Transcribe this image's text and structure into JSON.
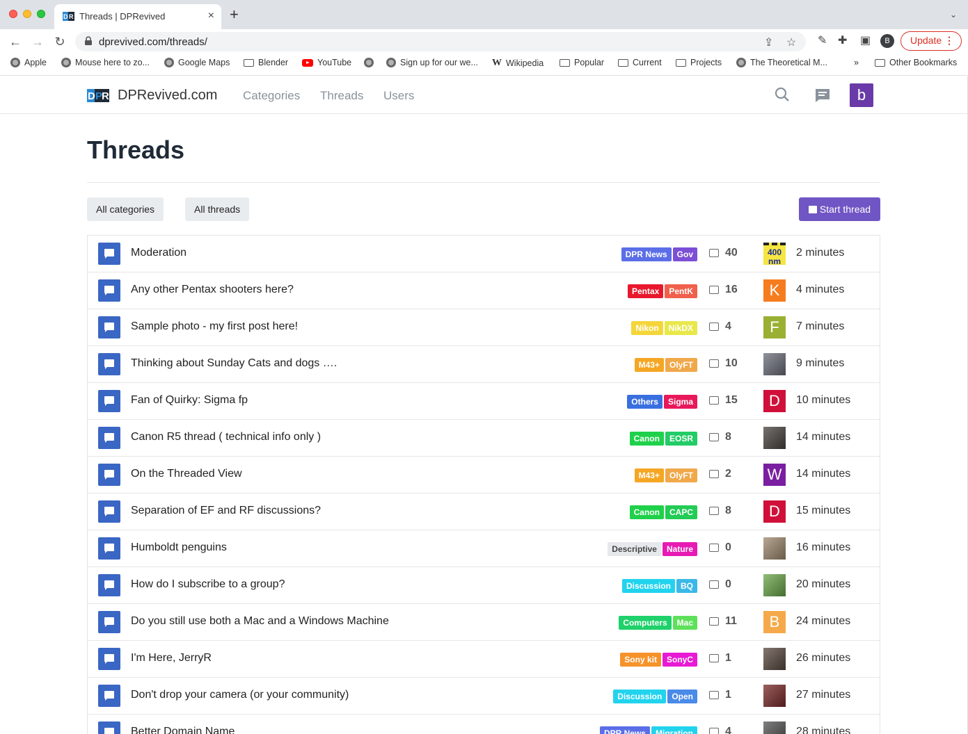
{
  "browser": {
    "tab_title": "Threads | DPRevived",
    "url": "dprevived.com/threads/",
    "update_label": "Update",
    "profile_initial": "B",
    "bookmarks": [
      {
        "label": "Apple",
        "icon": "globe-icon"
      },
      {
        "label": "Mouse here to zo...",
        "icon": "globe-icon"
      },
      {
        "label": "Google Maps",
        "icon": "globe-icon"
      },
      {
        "label": "Blender",
        "icon": "folder-icon"
      },
      {
        "label": "YouTube",
        "icon": "youtube-icon"
      },
      {
        "label": "",
        "icon": "globe-icon"
      },
      {
        "label": "Sign up for our we...",
        "icon": "globe-icon"
      },
      {
        "label": "Wikipedia",
        "icon": "wikipedia-icon"
      },
      {
        "label": "Popular",
        "icon": "folder-icon"
      },
      {
        "label": "Current",
        "icon": "folder-icon"
      },
      {
        "label": "Projects",
        "icon": "folder-icon"
      },
      {
        "label": "The Theoretical M...",
        "icon": "globe-icon"
      }
    ],
    "overflow": "»",
    "other_bookmarks": "Other Bookmarks"
  },
  "site": {
    "name": "DPRevived.com",
    "nav": [
      "Categories",
      "Threads",
      "Users"
    ],
    "user_initial": "b"
  },
  "page": {
    "title": "Threads",
    "filter_categories": "All categories",
    "filter_threads": "All threads",
    "start_thread": "Start thread"
  },
  "threads": [
    {
      "title": "Moderation",
      "tags": [
        {
          "label": "DPR News",
          "color": "#5b6ee8"
        },
        {
          "label": "Gov",
          "color": "#7c4fd6"
        }
      ],
      "replies": "40",
      "avatar": {
        "type": "image",
        "text": "400 nm",
        "bg": "#f5e642"
      },
      "time": "2 minutes"
    },
    {
      "title": "Any other Pentax shooters here?",
      "tags": [
        {
          "label": "Pentax",
          "color": "#e8192c"
        },
        {
          "label": "PentK",
          "color": "#f0604a"
        }
      ],
      "replies": "16",
      "avatar": {
        "type": "letter",
        "text": "K",
        "bg": "#f57c1f"
      },
      "time": "4 minutes"
    },
    {
      "title": "Sample photo - my first post here!",
      "tags": [
        {
          "label": "Nikon",
          "color": "#f5d63a"
        },
        {
          "label": "NikDX",
          "color": "#e8e84a"
        }
      ],
      "replies": "4",
      "avatar": {
        "type": "letter",
        "text": "F",
        "bg": "#9ab032"
      },
      "time": "7 minutes"
    },
    {
      "title": "Thinking about Sunday Cats and dogs ….",
      "tags": [
        {
          "label": "M43+",
          "color": "#f5a623"
        },
        {
          "label": "OlyFT",
          "color": "#f0a84a"
        }
      ],
      "replies": "10",
      "avatar": {
        "type": "photo",
        "text": "",
        "bg": "#6b6f7a"
      },
      "time": "9 minutes"
    },
    {
      "title": "Fan of Quirky: Sigma fp",
      "tags": [
        {
          "label": "Others",
          "color": "#3a6fe0"
        },
        {
          "label": "Sigma",
          "color": "#e8195a"
        }
      ],
      "replies": "15",
      "avatar": {
        "type": "letter",
        "text": "D",
        "bg": "#d0103a"
      },
      "time": "10 minutes"
    },
    {
      "title": "Canon R5 thread ( technical info only )",
      "tags": [
        {
          "label": "Canon",
          "color": "#1fd14a"
        },
        {
          "label": "EOSR",
          "color": "#22cc66"
        }
      ],
      "replies": "8",
      "avatar": {
        "type": "photo",
        "text": "",
        "bg": "#4a4440"
      },
      "time": "14 minutes"
    },
    {
      "title": "On the Threaded View",
      "tags": [
        {
          "label": "M43+",
          "color": "#f5a623"
        },
        {
          "label": "OlyFT",
          "color": "#f0a84a"
        }
      ],
      "replies": "2",
      "avatar": {
        "type": "letter",
        "text": "W",
        "bg": "#7a1fa2"
      },
      "time": "14 minutes"
    },
    {
      "title": "Separation of EF and RF discussions?",
      "tags": [
        {
          "label": "Canon",
          "color": "#1fd14a"
        },
        {
          "label": "CAPC",
          "color": "#22cc55"
        }
      ],
      "replies": "8",
      "avatar": {
        "type": "letter",
        "text": "D",
        "bg": "#d0103a"
      },
      "time": "15 minutes"
    },
    {
      "title": "Humboldt penguins",
      "tags": [
        {
          "label": "Descriptive",
          "color": "#e6e8ec"
        },
        {
          "label": "Nature",
          "color": "#e81ab4"
        }
      ],
      "replies": "0",
      "avatar": {
        "type": "photo",
        "text": "",
        "bg": "#a08a70"
      },
      "time": "16 minutes"
    },
    {
      "title": "How do I subscribe to a group?",
      "tags": [
        {
          "label": "Discussion",
          "color": "#22d3ee"
        },
        {
          "label": "BQ",
          "color": "#3ab8e8"
        }
      ],
      "replies": "0",
      "avatar": {
        "type": "photo",
        "text": "",
        "bg": "#6aa84a"
      },
      "time": "20 minutes"
    },
    {
      "title": "Do you still use both a Mac and a Windows Machine",
      "tags": [
        {
          "label": "Computers",
          "color": "#1fd16a"
        },
        {
          "label": "Mac",
          "color": "#5ee05a"
        }
      ],
      "replies": "11",
      "avatar": {
        "type": "letter",
        "text": "B",
        "bg": "#f5a94a"
      },
      "time": "24 minutes"
    },
    {
      "title": "I'm Here, JerryR",
      "tags": [
        {
          "label": "Sony kit",
          "color": "#f5932a"
        },
        {
          "label": "SonyC",
          "color": "#e81ad4"
        }
      ],
      "replies": "1",
      "avatar": {
        "type": "photo",
        "text": "",
        "bg": "#5a4a40"
      },
      "time": "26 minutes"
    },
    {
      "title": "Don't drop your camera (or your community)",
      "tags": [
        {
          "label": "Discussion",
          "color": "#22d3ee"
        },
        {
          "label": "Open",
          "color": "#4a8ae8"
        }
      ],
      "replies": "1",
      "avatar": {
        "type": "photo",
        "text": "",
        "bg": "#7a2a2a"
      },
      "time": "27 minutes"
    },
    {
      "title": "Better Domain Name",
      "tags": [
        {
          "label": "DPR News",
          "color": "#5b6ee8"
        },
        {
          "label": "Migration",
          "color": "#22d3ee"
        }
      ],
      "replies": "4",
      "avatar": {
        "type": "photo",
        "text": "",
        "bg": "#555"
      },
      "time": "28 minutes"
    }
  ]
}
